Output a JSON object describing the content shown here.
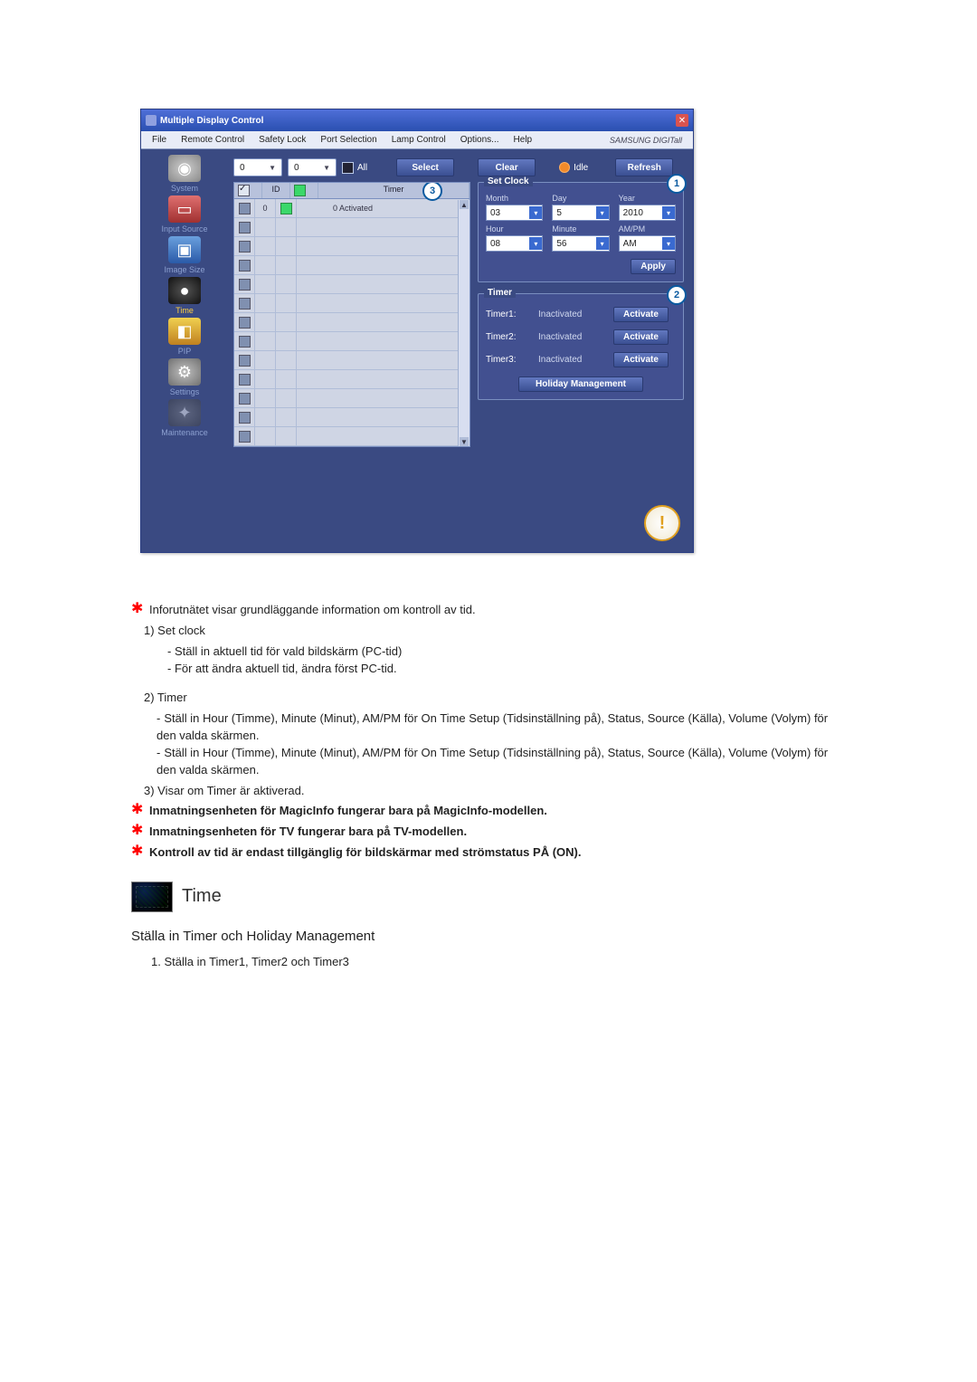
{
  "window": {
    "title": "Multiple Display Control",
    "brand": "SAMSUNG DIGITall"
  },
  "menubar": {
    "file": "File",
    "remote": "Remote Control",
    "safety": "Safety Lock",
    "port": "Port Selection",
    "lamp": "Lamp Control",
    "options": "Options...",
    "help": "Help"
  },
  "sidebar": {
    "system": "System",
    "input": "Input Source",
    "image": "Image Size",
    "time": "Time",
    "pip": "PIP",
    "settings": "Settings",
    "maint": "Maintenance"
  },
  "toolbar": {
    "dd1": "0",
    "dd2": "0",
    "all_label": "All",
    "select_label": "Select",
    "clear_label": "Clear",
    "idle_label": "Idle",
    "refresh_label": "Refresh"
  },
  "grid": {
    "hdr_id": "ID",
    "hdr_timer": "Timer",
    "row0_id": "0",
    "row0_timer": "0 Activated"
  },
  "badges": {
    "b1": "1",
    "b2": "2",
    "b3": "3"
  },
  "clock": {
    "title": "Set Clock",
    "month_l": "Month",
    "month_v": "03",
    "day_l": "Day",
    "day_v": "5",
    "year_l": "Year",
    "year_v": "2010",
    "hour_l": "Hour",
    "hour_v": "08",
    "min_l": "Minute",
    "min_v": "56",
    "ampm_l": "AM/PM",
    "ampm_v": "AM",
    "apply": "Apply"
  },
  "timer": {
    "title": "Timer",
    "t1_l": "Timer1:",
    "t1_s": "Inactivated",
    "t2_l": "Timer2:",
    "t2_s": "Inactivated",
    "t3_l": "Timer3:",
    "t3_s": "Inactivated",
    "activate": "Activate",
    "holiday": "Holiday Management"
  },
  "doc": {
    "p0": "Inforutnätet visar grundläggande information om kontroll av tid.",
    "n1": "1)  Set clock",
    "n1a": "- Ställ in aktuell tid för vald bildskärm (PC-tid)",
    "n1b": "- För att ändra aktuell tid, ändra först PC-tid.",
    "n2": "2)  Timer",
    "n2a": "Ställ in Hour (Timme), Minute (Minut), AM/PM för On Time Setup (Tidsinställning på), Status, Source (Källa), Volume (Volym) för den valda skärmen.",
    "n2b": "Ställ in Hour (Timme), Minute (Minut), AM/PM för On Time Setup (Tidsinställning på), Status, Source (Källa), Volume (Volym) för den valda skärmen.",
    "n3": "3)  Visar om Timer är aktiverad.",
    "s1": "Inmatningsenheten för MagicInfo fungerar bara på MagicInfo-modellen.",
    "s2": "Inmatningsenheten för TV fungerar bara på TV-modellen.",
    "s3": "Kontroll av tid är endast tillgänglig för bildskärmar med strömstatus PÅ (ON).",
    "sec_title": "Time",
    "sub_title": "Ställa in Timer och Holiday Management",
    "ol1": "1.  Ställa in Timer1, Timer2 och Timer3"
  }
}
